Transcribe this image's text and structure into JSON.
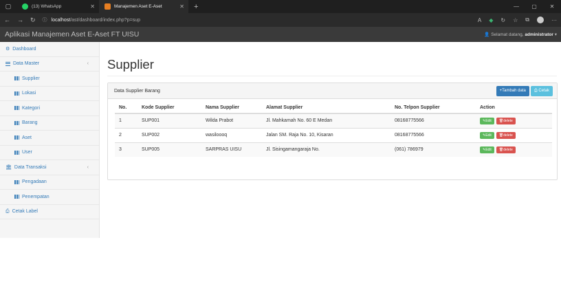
{
  "browser": {
    "tab1_title": "(13) WhatsApp",
    "tab2_title": "Manajemen Aset E-Aset",
    "url_host": "localhost",
    "url_path": "/ast/dashboard/index.php?p=sup"
  },
  "header": {
    "app_title": "Aplikasi Manajemen Aset E-Aset FT UISU",
    "welcome_prefix": "Selamat datang,",
    "username": "administrator"
  },
  "sidebar": {
    "items": [
      {
        "label": "Dashboard"
      },
      {
        "label": "Data Master"
      },
      {
        "label": "Supplier"
      },
      {
        "label": "Lokasi"
      },
      {
        "label": "Kategori"
      },
      {
        "label": "Barang"
      },
      {
        "label": "Aset"
      },
      {
        "label": "User"
      },
      {
        "label": "Data Transaksi"
      },
      {
        "label": "Pengadaan"
      },
      {
        "label": "Penempatan"
      },
      {
        "label": "Cetak Label"
      }
    ]
  },
  "main": {
    "page_title": "Supplier",
    "panel_title": "Data Supplier Barang",
    "add_button": "Tambah data",
    "print_button": "Cetak",
    "columns": [
      "No.",
      "Kode Supplier",
      "Nama Supplier",
      "Alamat Supplier",
      "No. Telpon Supplier",
      "Action"
    ],
    "rows": [
      {
        "no": "1",
        "kode": "SUP001",
        "nama": "Wilda Prabot",
        "alamat": "Jl. Mahkamah No. 60 E Medan",
        "telp": "08168775566"
      },
      {
        "no": "2",
        "kode": "SUP002",
        "nama": "wasiloooq",
        "alamat": "Jalan SM. Raja No. 10, Kisaran",
        "telp": "08168775566"
      },
      {
        "no": "3",
        "kode": "SUP005",
        "nama": "SARPRAS UISU",
        "alamat": "Jl. Sisingamangaraja No.",
        "telp": "(061) 786979"
      }
    ],
    "edit_label": "Edit",
    "delete_label": "delete"
  }
}
